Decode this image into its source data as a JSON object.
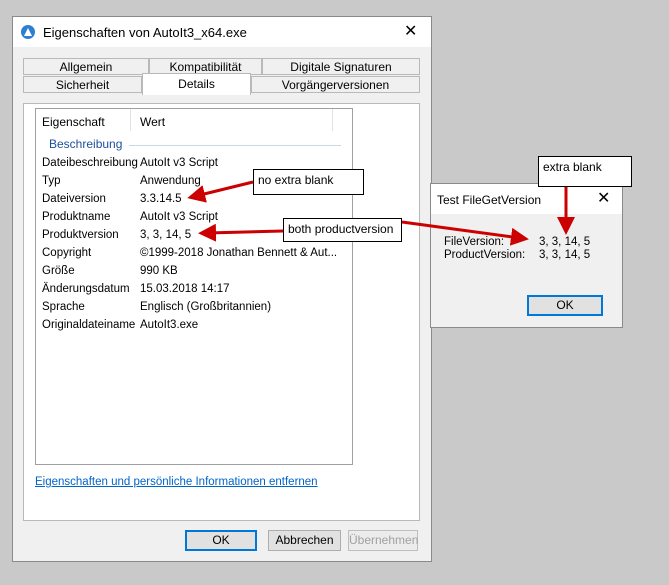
{
  "props_window": {
    "title": "Eigenschaften von AutoIt3_x64.exe",
    "tabs_row1": [
      "Allgemein",
      "Kompatibilität",
      "Digitale Signaturen"
    ],
    "tabs_row2": [
      "Sicherheit",
      "Details",
      "Vorgängerversionen"
    ],
    "active_tab": "Details",
    "columns": [
      "Eigenschaft",
      "Wert"
    ],
    "group": "Beschreibung",
    "rows": [
      {
        "label": "Dateibeschreibung",
        "value": "AutoIt v3 Script"
      },
      {
        "label": "Typ",
        "value": "Anwendung"
      },
      {
        "label": "Dateiversion",
        "value": "3.3.14.5"
      },
      {
        "label": "Produktname",
        "value": "AutoIt v3 Script"
      },
      {
        "label": "Produktversion",
        "value": "3, 3, 14, 5"
      },
      {
        "label": "Copyright",
        "value": "©1999-2018 Jonathan Bennett & Aut..."
      },
      {
        "label": "Größe",
        "value": "990 KB"
      },
      {
        "label": "Änderungsdatum",
        "value": "15.03.2018 14:17"
      },
      {
        "label": "Sprache",
        "value": "Englisch (Großbritannien)"
      },
      {
        "label": "Originaldateiname",
        "value": "AutoIt3.exe"
      }
    ],
    "remove_link": "Eigenschaften und persönliche Informationen entfernen",
    "buttons": {
      "ok": "OK",
      "cancel": "Abbrechen",
      "apply": "Übernehmen"
    }
  },
  "test_dialog": {
    "title": "Test FileGetVersion",
    "file_version_label": "FileVersion:",
    "file_version_value": "3, 3, 14, 5",
    "product_version_label": "ProductVersion:",
    "product_version_value": "3, 3, 14, 5",
    "ok": "OK"
  },
  "annotations": {
    "no_extra_blank": "no extra blank",
    "both_productversion": "both productversion",
    "extra_blank": "extra blank"
  },
  "icons": {
    "app": "autoit-icon",
    "close": "close-icon"
  },
  "colors": {
    "accent": "#0078d7",
    "group": "#1c4f9e",
    "arrow": "#cc0000",
    "link": "#0064c8"
  }
}
